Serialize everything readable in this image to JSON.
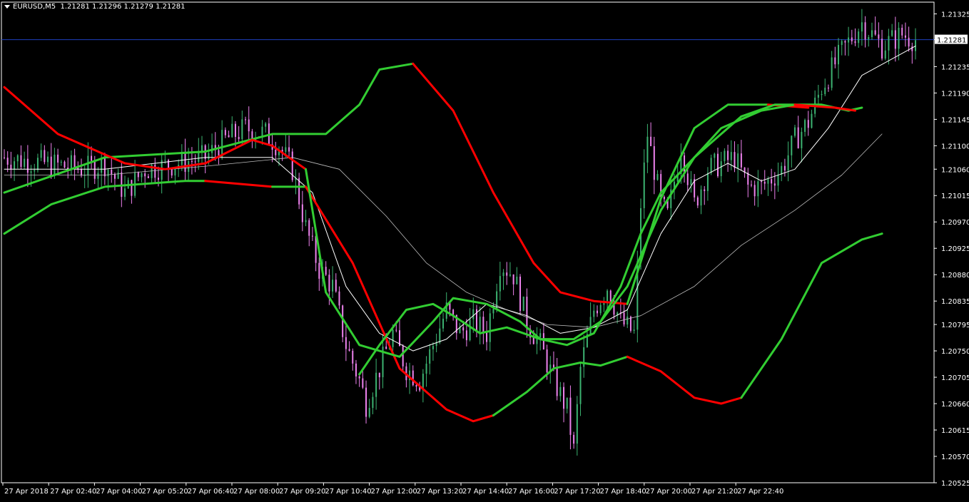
{
  "window": {
    "symbol": "EURUSD,M5",
    "ohlc": "1.21281 1.21296 1.21279 1.21281"
  },
  "colors": {
    "background": "#000000",
    "axis": "#ffffff",
    "bull": "#3cb371",
    "bear": "#ee82ee",
    "band_up": "#32cd32",
    "band_down": "#ff0000",
    "ma_fast": "#ffffff",
    "ma_slow": "#bdbdbd",
    "current_price": "#1e3fbf"
  },
  "chart_data": {
    "type": "candlestick",
    "price_labels": [
      "1.21325",
      "1.21281",
      "1.21235",
      "1.21190",
      "1.21145",
      "1.21100",
      "1.21060",
      "1.21015",
      "1.20970",
      "1.20925",
      "1.20880",
      "1.20835",
      "1.20795",
      "1.20750",
      "1.20705",
      "1.20660",
      "1.20615",
      "1.20570",
      "1.20525"
    ],
    "current_price": 1.21281,
    "ylim": [
      1.20525,
      1.21345
    ],
    "time_labels": [
      "27 Apr 2018",
      "27 Apr 02:40",
      "27 Apr 04:00",
      "27 Apr 05:20",
      "27 Apr 06:40",
      "27 Apr 08:00",
      "27 Apr 09:20",
      "27 Apr 10:40",
      "27 Apr 12:00",
      "27 Apr 13:20",
      "27 Apr 14:40",
      "27 Apr 16:00",
      "27 Apr 17:20",
      "27 Apr 18:40",
      "27 Apr 20:00",
      "27 Apr 21:20",
      "27 Apr 22:40"
    ],
    "close_trajectory": [
      [
        0,
        1.2108
      ],
      [
        24,
        1.2106
      ],
      [
        30,
        1.2107
      ],
      [
        36,
        1.2102
      ],
      [
        42,
        1.2106
      ],
      [
        52,
        1.2107
      ],
      [
        60,
        1.2108
      ],
      [
        66,
        1.2111
      ],
      [
        72,
        1.2113
      ],
      [
        78,
        1.2112
      ],
      [
        82,
        1.211
      ],
      [
        86,
        1.2106
      ],
      [
        90,
        1.2096
      ],
      [
        94,
        1.2089
      ],
      [
        98,
        1.2086
      ],
      [
        102,
        1.2076
      ],
      [
        106,
        1.207
      ],
      [
        108,
        1.2066
      ],
      [
        112,
        1.2072
      ],
      [
        116,
        1.2078
      ],
      [
        120,
        1.2072
      ],
      [
        124,
        1.207
      ],
      [
        128,
        1.2076
      ],
      [
        132,
        1.2082
      ],
      [
        136,
        1.2078
      ],
      [
        140,
        1.208
      ],
      [
        144,
        1.2078
      ],
      [
        148,
        1.209
      ],
      [
        152,
        1.2088
      ],
      [
        156,
        1.208
      ],
      [
        160,
        1.2076
      ],
      [
        164,
        1.207
      ],
      [
        168,
        1.2065
      ],
      [
        170,
        1.2058
      ],
      [
        172,
        1.2072
      ],
      [
        176,
        1.2082
      ],
      [
        180,
        1.2086
      ],
      [
        184,
        1.208
      ],
      [
        188,
        1.2078
      ],
      [
        190,
        1.21
      ],
      [
        192,
        1.2112
      ],
      [
        196,
        1.21
      ],
      [
        198,
        1.2098
      ],
      [
        202,
        1.211
      ],
      [
        206,
        1.21
      ],
      [
        210,
        1.2106
      ],
      [
        214,
        1.2107
      ],
      [
        218,
        1.2108
      ],
      [
        222,
        1.2103
      ],
      [
        226,
        1.2103
      ],
      [
        232,
        1.2106
      ],
      [
        236,
        1.2111
      ],
      [
        240,
        1.2114
      ],
      [
        244,
        1.212
      ],
      [
        250,
        1.2126
      ],
      [
        256,
        1.2131
      ],
      [
        262,
        1.2127
      ],
      [
        268,
        1.2129
      ],
      [
        272,
        1.21281
      ]
    ],
    "bar_count": 273,
    "upper_band": [
      {
        "color": "down",
        "points": [
          [
            0,
            1.212
          ],
          [
            16,
            1.2112
          ],
          [
            36,
            1.2107
          ],
          [
            48,
            1.2106
          ],
          [
            60,
            1.2107
          ],
          [
            74,
            1.2111
          ],
          [
            80,
            1.211
          ],
          [
            90,
            1.2106
          ]
        ]
      },
      {
        "color": "up",
        "points": [
          [
            90,
            1.2106
          ],
          [
            96,
            1.2085
          ],
          [
            106,
            1.2076
          ],
          [
            118,
            1.2074
          ],
          [
            128,
            1.208
          ],
          [
            134,
            1.2084
          ],
          [
            144,
            1.2083
          ],
          [
            154,
            1.208
          ],
          [
            160,
            1.2077
          ],
          [
            170,
            1.2077
          ],
          [
            178,
            1.208
          ],
          [
            186,
            1.2086
          ],
          [
            196,
            1.2099
          ],
          [
            206,
            1.2108
          ],
          [
            214,
            1.2113
          ],
          [
            226,
            1.2116
          ],
          [
            236,
            1.2117
          ]
        ]
      },
      {
        "color": "up",
        "points": [
          [
            106,
            1.2071
          ],
          [
            112,
            1.2076
          ],
          [
            120,
            1.2082
          ],
          [
            128,
            1.2083
          ],
          [
            134,
            1.2081
          ],
          [
            142,
            1.2078
          ],
          [
            150,
            1.2079
          ],
          [
            160,
            1.2077
          ],
          [
            168,
            1.2076
          ],
          [
            176,
            1.2078
          ],
          [
            184,
            1.2086
          ],
          [
            190,
            1.2095
          ],
          [
            196,
            1.2102
          ],
          [
            206,
            1.2108
          ],
          [
            214,
            1.2112
          ],
          [
            220,
            1.2115
          ],
          [
            230,
            1.2117
          ],
          [
            244,
            1.2117
          ],
          [
            252,
            1.2116
          ],
          [
            256,
            1.21165
          ]
        ]
      },
      {
        "color": "down",
        "points": [
          [
            236,
            1.2117
          ],
          [
            248,
            1.21165
          ],
          [
            254,
            1.2116
          ]
        ]
      }
    ],
    "envelope_upper": [
      {
        "color": "up",
        "points": [
          [
            0,
            1.2102
          ],
          [
            30,
            1.2108
          ],
          [
            60,
            1.2109
          ],
          [
            80,
            1.2112
          ],
          [
            96,
            1.2112
          ],
          [
            106,
            1.2117
          ],
          [
            112,
            1.2123
          ],
          [
            122,
            1.2124
          ]
        ]
      },
      {
        "color": "down",
        "points": [
          [
            122,
            1.2124
          ],
          [
            134,
            1.2116
          ],
          [
            146,
            1.2102
          ],
          [
            158,
            1.209
          ],
          [
            166,
            1.2085
          ],
          [
            176,
            1.20835
          ],
          [
            186,
            1.2083
          ]
        ]
      },
      {
        "color": "up",
        "points": [
          [
            186,
            1.2083
          ],
          [
            196,
            1.2101
          ],
          [
            206,
            1.2113
          ],
          [
            216,
            1.2117
          ],
          [
            228,
            1.2117
          ]
        ]
      },
      {
        "color": "down",
        "points": [
          [
            228,
            1.2117
          ],
          [
            240,
            1.21165
          ]
        ]
      }
    ],
    "envelope_lower": [
      {
        "color": "up",
        "points": [
          [
            0,
            1.2095
          ],
          [
            14,
            1.21
          ],
          [
            30,
            1.2103
          ],
          [
            54,
            1.2104
          ],
          [
            60,
            1.2104
          ]
        ]
      },
      {
        "color": "down",
        "points": [
          [
            60,
            1.2104
          ],
          [
            80,
            1.2103
          ]
        ]
      },
      {
        "color": "up",
        "points": [
          [
            80,
            1.2103
          ],
          [
            90,
            1.2103
          ]
        ]
      },
      {
        "color": "down",
        "points": [
          [
            90,
            1.2103
          ],
          [
            104,
            1.209
          ],
          [
            118,
            1.2072
          ],
          [
            132,
            1.2065
          ],
          [
            140,
            1.2063
          ],
          [
            146,
            1.2064
          ]
        ]
      },
      {
        "color": "up",
        "points": [
          [
            146,
            1.2064
          ],
          [
            156,
            1.2068
          ],
          [
            164,
            1.2072
          ],
          [
            172,
            1.2073
          ],
          [
            178,
            1.20725
          ],
          [
            186,
            1.2074
          ]
        ]
      },
      {
        "color": "down",
        "points": [
          [
            186,
            1.2074
          ],
          [
            196,
            1.20715
          ],
          [
            206,
            1.2067
          ],
          [
            214,
            1.2066
          ],
          [
            220,
            1.2067
          ]
        ]
      },
      {
        "color": "up",
        "points": [
          [
            220,
            1.2067
          ],
          [
            232,
            1.2077
          ],
          [
            244,
            1.209
          ],
          [
            256,
            1.2094
          ],
          [
            262,
            1.2095
          ]
        ]
      }
    ],
    "ma_fast": [
      [
        0,
        1.2106
      ],
      [
        30,
        1.2106
      ],
      [
        60,
        1.2108
      ],
      [
        80,
        1.2108
      ],
      [
        92,
        1.2102
      ],
      [
        102,
        1.2086
      ],
      [
        112,
        1.2078
      ],
      [
        122,
        1.2075
      ],
      [
        132,
        1.2077
      ],
      [
        144,
        1.2083
      ],
      [
        156,
        1.2081
      ],
      [
        166,
        1.2078
      ],
      [
        176,
        1.2079
      ],
      [
        186,
        1.2082
      ],
      [
        196,
        1.2095
      ],
      [
        206,
        1.2104
      ],
      [
        216,
        1.2107
      ],
      [
        226,
        1.2104
      ],
      [
        236,
        1.2106
      ],
      [
        246,
        1.2113
      ],
      [
        256,
        1.2122
      ],
      [
        272,
        1.2127
      ]
    ],
    "ma_slow": [
      [
        0,
        1.2105
      ],
      [
        30,
        1.2105
      ],
      [
        60,
        1.21065
      ],
      [
        86,
        1.2108
      ],
      [
        100,
        1.2106
      ],
      [
        114,
        1.2098
      ],
      [
        126,
        1.209
      ],
      [
        138,
        1.2085
      ],
      [
        150,
        1.2082
      ],
      [
        162,
        1.20795
      ],
      [
        176,
        1.2079
      ],
      [
        190,
        1.2081
      ],
      [
        206,
        1.2086
      ],
      [
        220,
        1.2093
      ],
      [
        236,
        1.2099
      ],
      [
        250,
        1.2105
      ],
      [
        262,
        1.2112
      ]
    ]
  }
}
